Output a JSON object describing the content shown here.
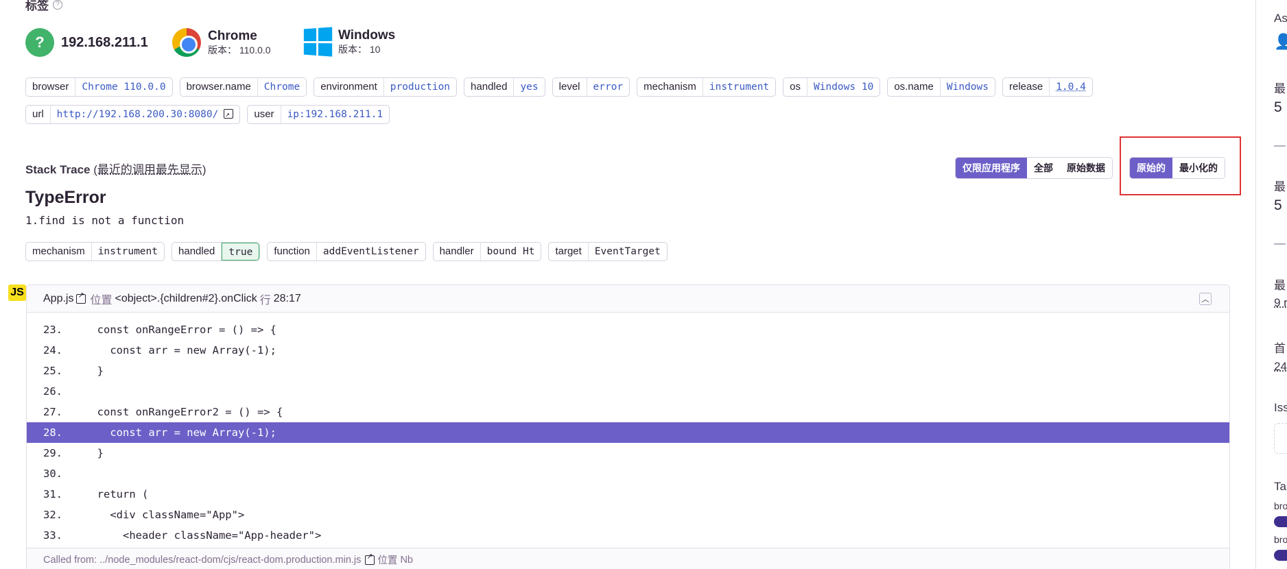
{
  "header": {
    "title": "标签",
    "help_icon": "?"
  },
  "context": [
    {
      "icon": "question-circle-icon",
      "name": "192.168.211.1"
    },
    {
      "icon": "chrome-icon",
      "name": "Chrome",
      "version_label": "版本：",
      "version": "110.0.0"
    },
    {
      "icon": "windows-icon",
      "name": "Windows",
      "version_label": "版本：",
      "version": "10"
    }
  ],
  "tags_row1": [
    {
      "key": "browser",
      "value": "Chrome 110.0.0"
    },
    {
      "key": "browser.name",
      "value": "Chrome"
    },
    {
      "key": "environment",
      "value": "production"
    },
    {
      "key": "handled",
      "value": "yes"
    },
    {
      "key": "level",
      "value": "error"
    },
    {
      "key": "mechanism",
      "value": "instrument"
    },
    {
      "key": "os",
      "value": "Windows 10"
    },
    {
      "key": "os.name",
      "value": "Windows"
    },
    {
      "key": "release",
      "value": "1.0.4"
    }
  ],
  "tags_row2": [
    {
      "key": "url",
      "value": "http://192.168.200.30:8080/"
    },
    {
      "key": "user",
      "value": "ip:192.168.211.1"
    }
  ],
  "stack_trace": {
    "title": "Stack Trace",
    "subtitle": "(最近的调用最先显示)",
    "filter_buttons": [
      "仅限应用程序",
      "全部",
      "原始数据"
    ],
    "filter_active": "仅限应用程序",
    "view_buttons": [
      "原始的",
      "最小化的"
    ],
    "view_active": "原始的"
  },
  "error": {
    "type": "TypeError",
    "message": "1.find is not a function"
  },
  "mechanism_tags": [
    {
      "key": "mechanism",
      "value": "instrument"
    },
    {
      "key": "handled",
      "value": "true"
    },
    {
      "key": "function",
      "value": "addEventListener"
    },
    {
      "key": "handler",
      "value": "bound Ht"
    },
    {
      "key": "target",
      "value": "EventTarget"
    }
  ],
  "frame": {
    "badge": "JS",
    "file": "App.js",
    "in_label": "位置",
    "function": "<object>.{children#2}.onClick",
    "line_label": "行",
    "location": "28:17",
    "highlight_line": "28.",
    "lines": [
      {
        "no": "23.",
        "code": "  const onRangeError = () => {"
      },
      {
        "no": "24.",
        "code": "    const arr = new Array(-1);"
      },
      {
        "no": "25.",
        "code": "  }"
      },
      {
        "no": "26.",
        "code": ""
      },
      {
        "no": "27.",
        "code": "  const onRangeError2 = () => {"
      },
      {
        "no": "28.",
        "code": "    const arr = new Array(-1);"
      },
      {
        "no": "29.",
        "code": "  }"
      },
      {
        "no": "30.",
        "code": ""
      },
      {
        "no": "31.",
        "code": "  return ("
      },
      {
        "no": "32.",
        "code": "    <div className=\"App\">"
      },
      {
        "no": "33.",
        "code": "      <header className=\"App-header\">"
      }
    ],
    "called_from_label": "Called from: ../node_modules/react-dom/cjs/react-dom.production.min.js",
    "called_from_in": "位置",
    "called_from_fn": "Nb"
  },
  "sidebar": {
    "items": [
      "As",
      "最",
      "5",
      "—",
      "最",
      "5",
      "—",
      "最",
      "9 r",
      "首",
      "24",
      "Iss",
      "Ta",
      "bro",
      "bro"
    ]
  },
  "colors": {
    "accent": "#6c5fc7",
    "link": "#3a59c4",
    "highlight_box": "#e03131"
  }
}
